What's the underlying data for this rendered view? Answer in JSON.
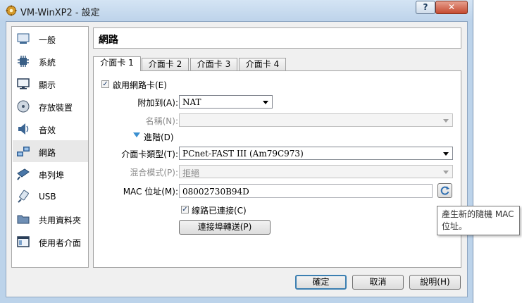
{
  "window": {
    "title": "VM-WinXP2 - 設定",
    "help_label": "?",
    "close_label": "✕"
  },
  "sidebar": {
    "items": [
      {
        "label": "一般",
        "icon": "general-icon"
      },
      {
        "label": "系統",
        "icon": "system-chip-icon"
      },
      {
        "label": "顯示",
        "icon": "display-monitor-icon"
      },
      {
        "label": "存放裝置",
        "icon": "storage-disk-icon"
      },
      {
        "label": "音效",
        "icon": "speaker-icon"
      },
      {
        "label": "網路",
        "icon": "network-icon",
        "selected": true
      },
      {
        "label": "串列埠",
        "icon": "serial-port-icon"
      },
      {
        "label": "USB",
        "icon": "usb-icon"
      },
      {
        "label": "共用資料夾",
        "icon": "folder-icon"
      },
      {
        "label": "使用者介面",
        "icon": "user-interface-icon"
      }
    ]
  },
  "main": {
    "title": "網路",
    "tabs": [
      {
        "label": "介面卡 1",
        "active": true
      },
      {
        "label": "介面卡 2"
      },
      {
        "label": "介面卡 3"
      },
      {
        "label": "介面卡 4"
      }
    ]
  },
  "form": {
    "enable_label": "啟用網路卡(E)",
    "enable_checked": true,
    "attached_label": "附加到(A):",
    "attached_value": "NAT",
    "name_label": "名稱(N):",
    "name_value": "",
    "advanced_label": "進階(D)",
    "adapter_type_label": "介面卡類型(T):",
    "adapter_type_value": "PCnet-FAST III (Am79C973)",
    "promisc_label": "混合模式(P):",
    "promisc_value": "拒絕",
    "mac_label": "MAC 位址(M):",
    "mac_value": "08002730B94D",
    "cable_label": "線路已連接(C)",
    "cable_checked": true,
    "port_forward_label": "連接埠轉送(P)"
  },
  "buttons": {
    "ok": "確定",
    "cancel": "取消",
    "help": "說明(H)"
  },
  "tooltip": {
    "text": "產生新的隨機 MAC 位址。"
  },
  "colors": {
    "accent": "#3c7fb1",
    "titlebar": "#bdd3ea",
    "close": "#c54a30"
  }
}
